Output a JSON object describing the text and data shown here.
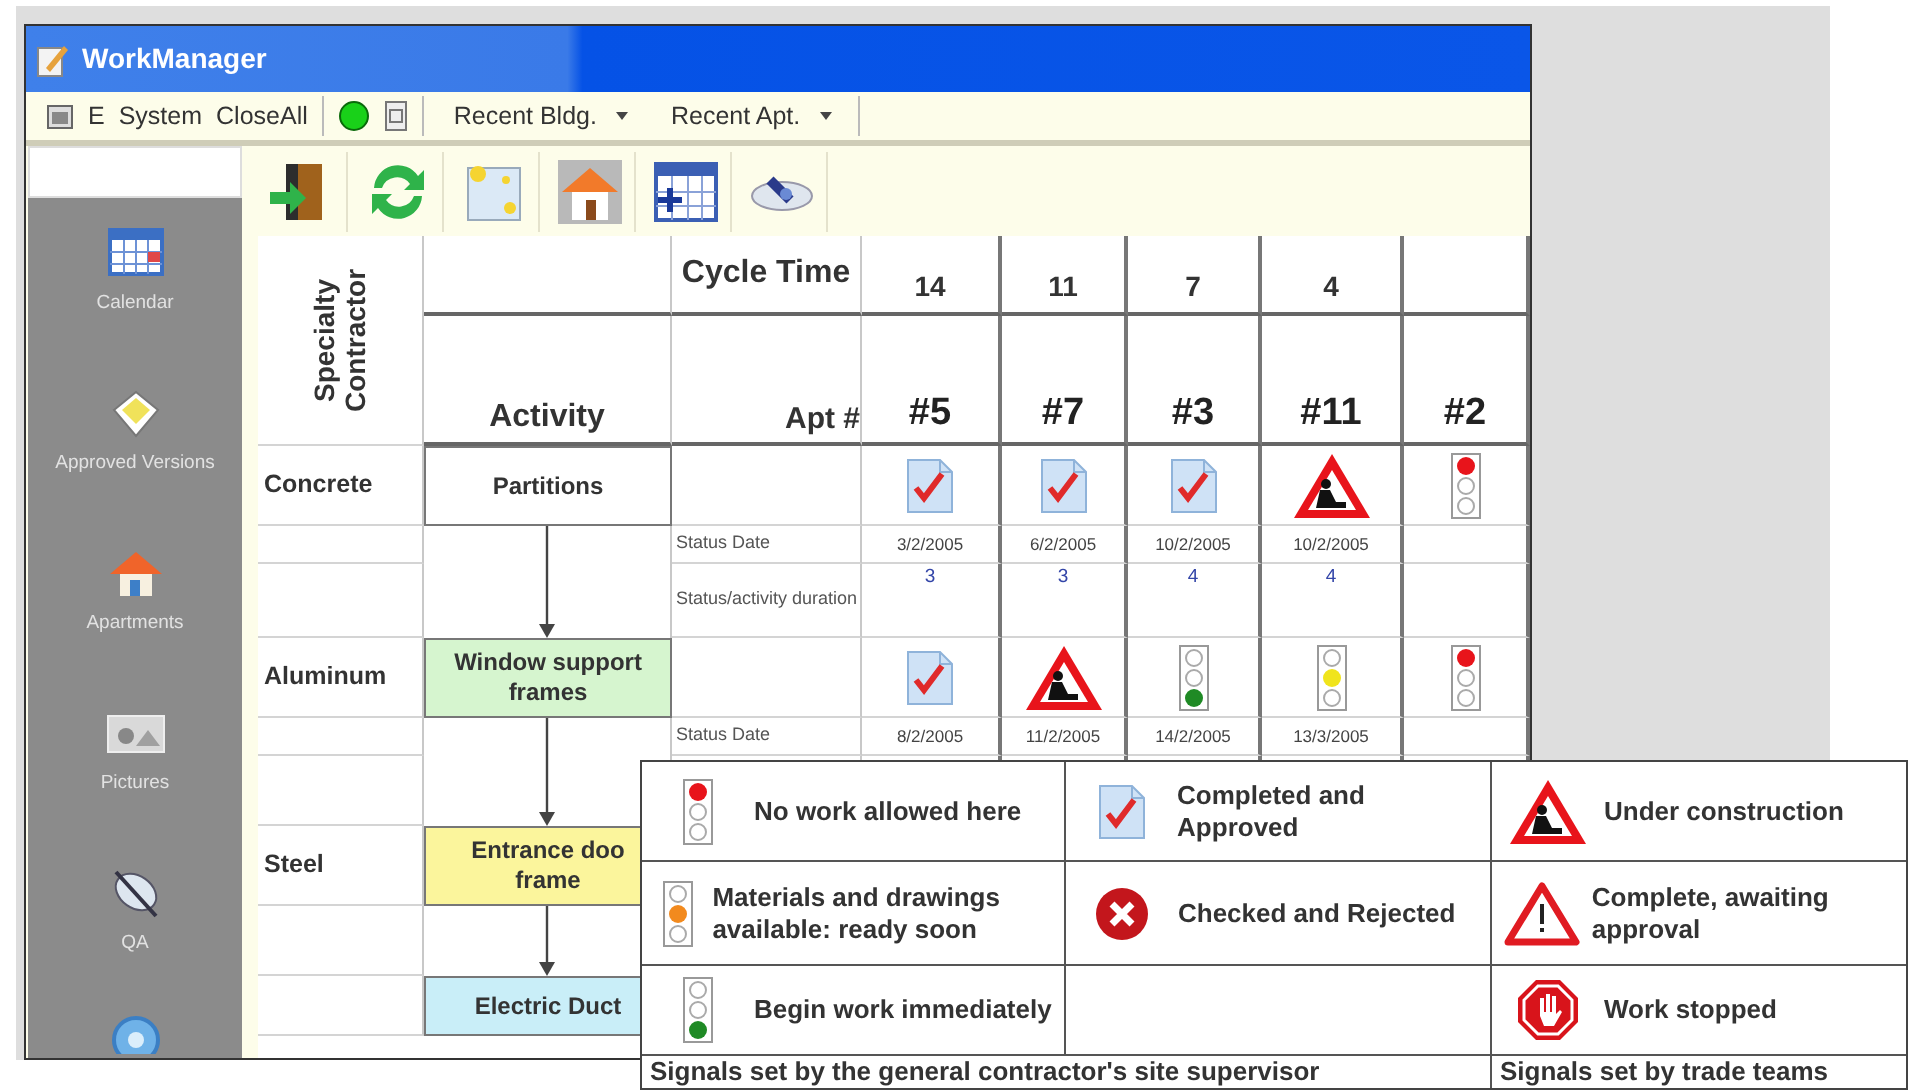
{
  "window": {
    "title": "WorkManager"
  },
  "menu_bar": {
    "items": [
      "E",
      "System",
      "CloseAll"
    ],
    "dropdowns": [
      "Recent Bldg.",
      "Recent Apt."
    ]
  },
  "sidebar": {
    "items": [
      "Calendar",
      "Approved Versions",
      "Apartments",
      "Pictures",
      "QA"
    ]
  },
  "schedule": {
    "contractor_header": "Specialty Contractor",
    "activity_header": "Activity",
    "cycle_label": "Cycle Time",
    "apt_label": "Apt #",
    "apartments": [
      {
        "number": "#5",
        "cycle_time": "14"
      },
      {
        "number": "#7",
        "cycle_time": "11"
      },
      {
        "number": "#3",
        "cycle_time": "7"
      },
      {
        "number": "#11",
        "cycle_time": "4"
      },
      {
        "number": "#2"
      }
    ],
    "rows": [
      {
        "contractor": "Concrete",
        "activity": "Partitions",
        "color": "#ffffff",
        "statuses": [
          {
            "kind": "approved"
          },
          {
            "kind": "approved"
          },
          {
            "kind": "approved"
          },
          {
            "kind": "construction"
          },
          {
            "kind": "red-light",
            "color": "#e8141b"
          }
        ],
        "status_date_label": "Status Date",
        "status_dates": [
          "3/2/2005",
          "6/2/2005",
          "10/2/2005",
          "10/2/2005"
        ],
        "duration_label": "Status/activity duration",
        "durations": [
          "3",
          "3",
          "4",
          "4"
        ]
      },
      {
        "contractor": "Aluminum",
        "activity": "Window support frames",
        "color": "#d6f5cf",
        "statuses": [
          {
            "kind": "approved"
          },
          {
            "kind": "construction"
          },
          {
            "kind": "green-light",
            "color": "#1f8a25"
          },
          {
            "kind": "amber-light",
            "color": "#f0e41c"
          },
          {
            "kind": "red-light",
            "color": "#e8141b"
          }
        ],
        "status_date_label": "Status Date",
        "status_dates": [
          "8/2/2005",
          "11/2/2005",
          "14/2/2005",
          "13/3/2005"
        ]
      },
      {
        "contractor": "Steel",
        "activity": "Entrance doo frame",
        "color": "#fbf59c"
      },
      {
        "activity": "Electric Duct",
        "color": "#c9eef8"
      }
    ]
  },
  "legend": {
    "groups": [
      {
        "caption": "Signals set by the general contractor's site supervisor",
        "items": [
          {
            "kind": "red-light",
            "color": "#e8141b",
            "text": "No work allowed here"
          },
          {
            "kind": "amber-light",
            "color": "#f28a1e",
            "text": "Materials and drawings available: ready soon"
          },
          {
            "kind": "green-light",
            "color": "#1f8a25",
            "text": "Begin work immediately"
          },
          {
            "kind": "approved",
            "text": "Completed and Approved"
          },
          {
            "kind": "rejected",
            "text": "Checked and Rejected"
          }
        ]
      },
      {
        "caption": "Signals set by trade teams",
        "items": [
          {
            "kind": "construction",
            "text": "Under construction"
          },
          {
            "kind": "warning",
            "text": "Complete, awaiting approval"
          },
          {
            "kind": "stop",
            "text": "Work stopped"
          }
        ]
      }
    ]
  }
}
